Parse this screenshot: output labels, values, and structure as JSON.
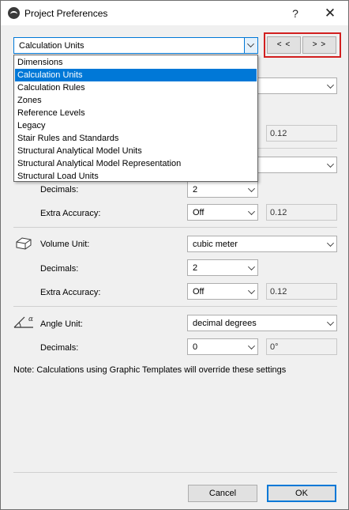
{
  "window": {
    "title": "Project Preferences",
    "help_label": "?",
    "close_label": "✕"
  },
  "page_selector": {
    "value": "Calculation Units",
    "prev_label": "< <",
    "next_label": "> >",
    "options": [
      "Dimensions",
      "Calculation Units",
      "Calculation Rules",
      "Zones",
      "Reference Levels",
      "Legacy",
      "Stair Rules and Standards",
      "Structural Analytical Model Units",
      "Structural Analytical Model Representation",
      "Structural Load Units"
    ],
    "selected_index": 1
  },
  "obscured_rows": {
    "extra_accuracy_value": "0.12"
  },
  "area": {
    "decimals_label": "Decimals:",
    "decimals_value": "2",
    "extra_accuracy_label": "Extra Accuracy:",
    "extra_accuracy_value": "Off",
    "extra_accuracy_readout": "0.12"
  },
  "volume": {
    "unit_label": "Volume Unit:",
    "unit_value": "cubic meter",
    "decimals_label": "Decimals:",
    "decimals_value": "2",
    "extra_accuracy_label": "Extra Accuracy:",
    "extra_accuracy_value": "Off",
    "extra_accuracy_readout": "0.12"
  },
  "angle": {
    "unit_label": "Angle Unit:",
    "unit_value": "decimal degrees",
    "decimals_label": "Decimals:",
    "decimals_value": "0",
    "readout": "0°"
  },
  "note": "Note: Calculations using Graphic Templates will override these settings",
  "footer": {
    "cancel_label": "Cancel",
    "ok_label": "OK"
  },
  "colors": {
    "accent": "#0078d7",
    "highlight_frame": "#d21f1f"
  }
}
